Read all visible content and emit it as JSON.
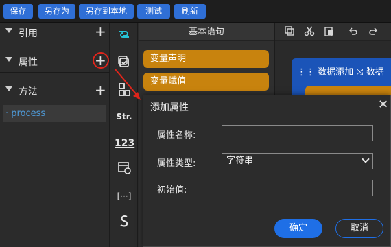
{
  "toolbar": {
    "save": "保存",
    "save_as": "另存为",
    "save_local": "另存到本地",
    "test": "测试",
    "refresh": "刷新"
  },
  "left_panel": {
    "sections": [
      {
        "label": "引用"
      },
      {
        "label": "属性"
      },
      {
        "label": "方法"
      }
    ],
    "method_item": "· process",
    "plus_glyph": "+"
  },
  "icon_column": {
    "str_label": "Str.",
    "num_label": "123",
    "bracket_label": "[···]"
  },
  "basic_panel": {
    "title": "基本语句",
    "items": [
      "变量声明",
      "变量赋值"
    ]
  },
  "workspace": {
    "flow_label": "⋮⋮ 数据添加 ⤨  数据"
  },
  "dialog": {
    "title": "添加属性",
    "close": "✕",
    "fields": [
      {
        "label": "属性名称:",
        "value": ""
      },
      {
        "label": "属性类型:",
        "value": "字符串"
      },
      {
        "label": "初始值:",
        "value": ""
      }
    ],
    "ok": "确定",
    "cancel": "取消"
  },
  "colors": {
    "accent": "#2f6fd6",
    "statement": "#c8830e",
    "highlight": "#e0251b"
  }
}
